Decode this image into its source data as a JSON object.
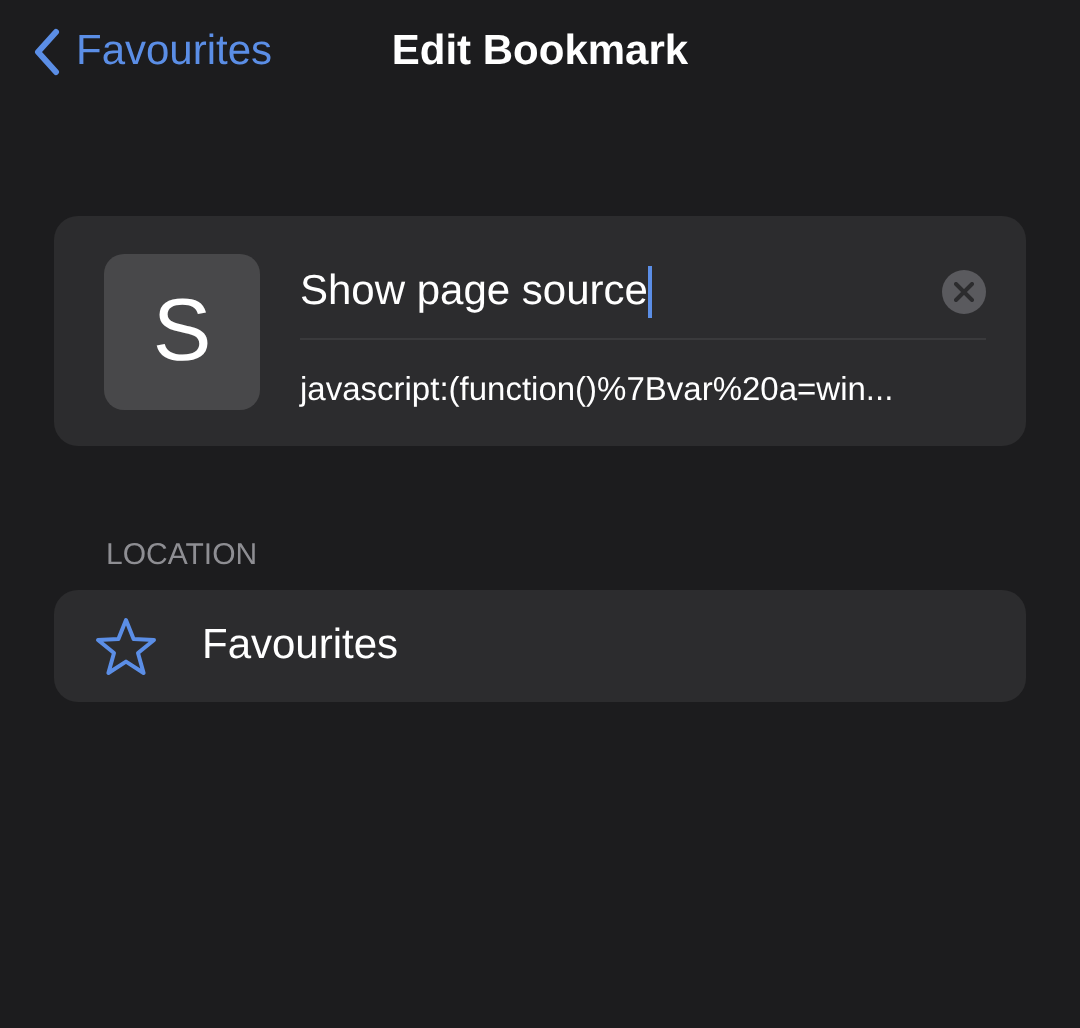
{
  "nav": {
    "back_label": "Favourites",
    "title": "Edit Bookmark"
  },
  "bookmark": {
    "icon_letter": "S",
    "title": "Show page source",
    "url": "javascript:(function()%7Bvar%20a=win..."
  },
  "location": {
    "header": "LOCATION",
    "folder": "Favourites"
  }
}
